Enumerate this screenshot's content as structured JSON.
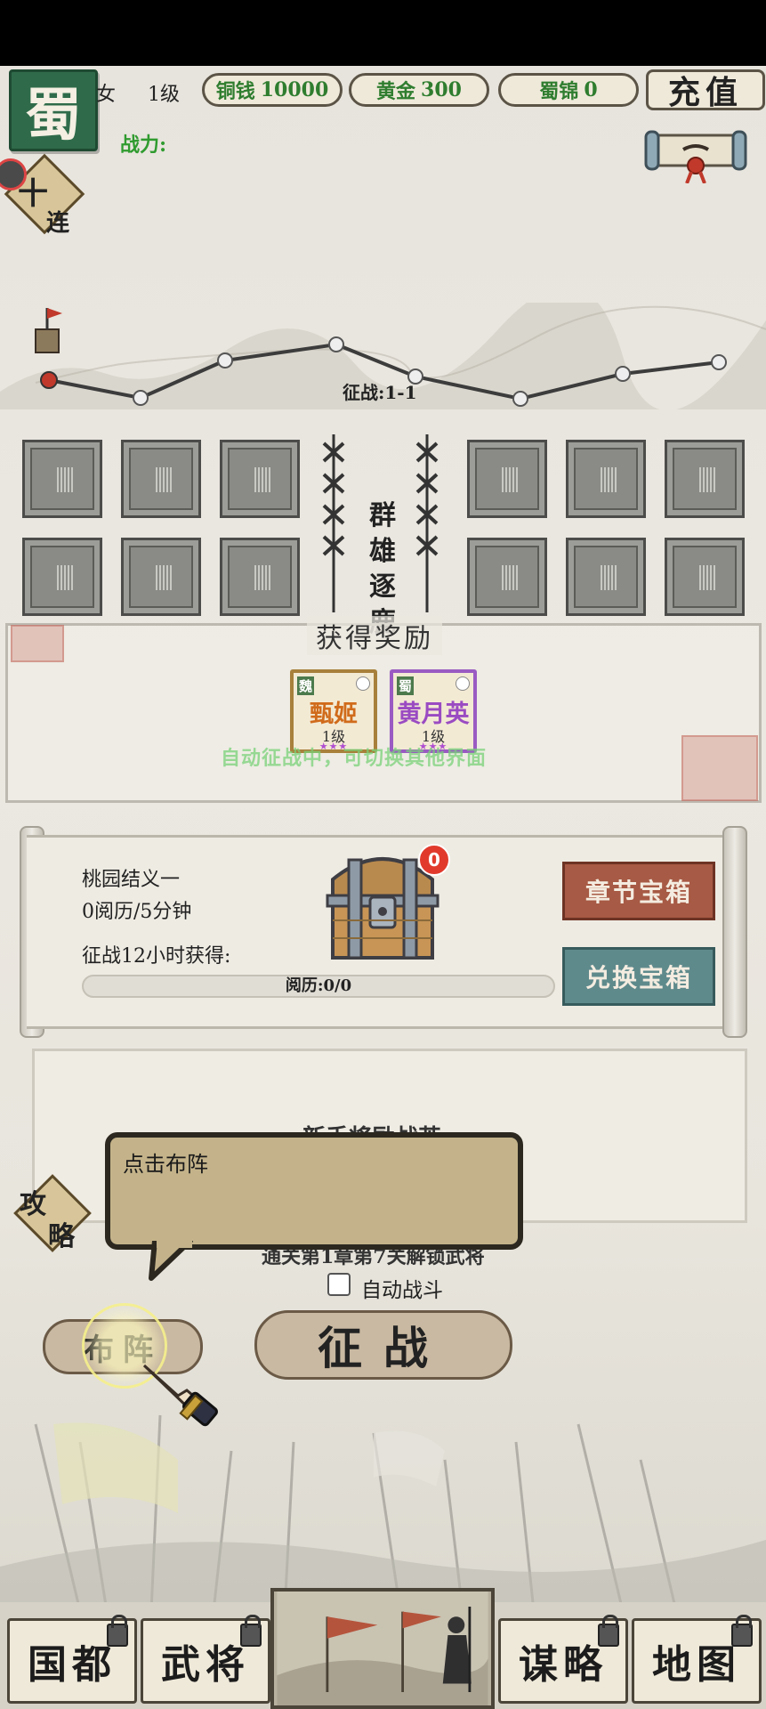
{
  "faction": "蜀",
  "player": {
    "gender": "女",
    "level": "1级",
    "power_label": "战力:"
  },
  "resources": {
    "copper": {
      "name": "铜钱",
      "value": "10000"
    },
    "gold": {
      "name": "黄金",
      "value": "300"
    },
    "brocade": {
      "name": "蜀锦",
      "value": "0"
    }
  },
  "recharge_label": "充值",
  "ten_draw": {
    "plus": "十",
    "label": "连"
  },
  "route": {
    "stage_label": "征战:1-1"
  },
  "battle_title": "群雄逐鹿",
  "rewards": {
    "title": "获得奖励",
    "cards": [
      {
        "kingdom": "魏",
        "name": "甄姬",
        "level": "1级",
        "stars": "★★★",
        "rarity": "orange"
      },
      {
        "kingdom": "蜀",
        "name": "黄月英",
        "level": "1级",
        "stars": "★★★",
        "rarity": "purple"
      }
    ],
    "auto_hint": "自动征战中，可切换其他界面"
  },
  "chapter": {
    "name": "桃园结义一",
    "rate": "0阅历/5分钟",
    "earn_label": "征战12小时获得:",
    "exp_label": "阅历:0/0",
    "exp_progress": 0,
    "chest_badge": "0",
    "chapter_box_label": "章节宝箱",
    "exchange_box_label": "兑换宝箱"
  },
  "new_general": {
    "title": "新手将励战英",
    "unlock_text": "通关第1章第7关解锁武将",
    "auto_battle_label": "自动战斗",
    "auto_battle_checked": false
  },
  "guide": {
    "line1": "攻",
    "line2": "略"
  },
  "tutorial": {
    "text": "点击布阵"
  },
  "actions": {
    "formation_label": "布阵",
    "battle_label": "征战"
  },
  "nav": {
    "items": [
      {
        "label": "国都",
        "locked": true
      },
      {
        "label": "武将",
        "locked": true
      },
      {
        "label": "谋略",
        "locked": true
      },
      {
        "label": "地图",
        "locked": true
      }
    ]
  },
  "colors": {
    "faction_green": "#2f6b4a",
    "resource_text": "#2f7d2f",
    "chapter_box": "#a75a45",
    "exchange_box": "#5f8a8c",
    "tutorial_bubble": "#c4b38a"
  }
}
